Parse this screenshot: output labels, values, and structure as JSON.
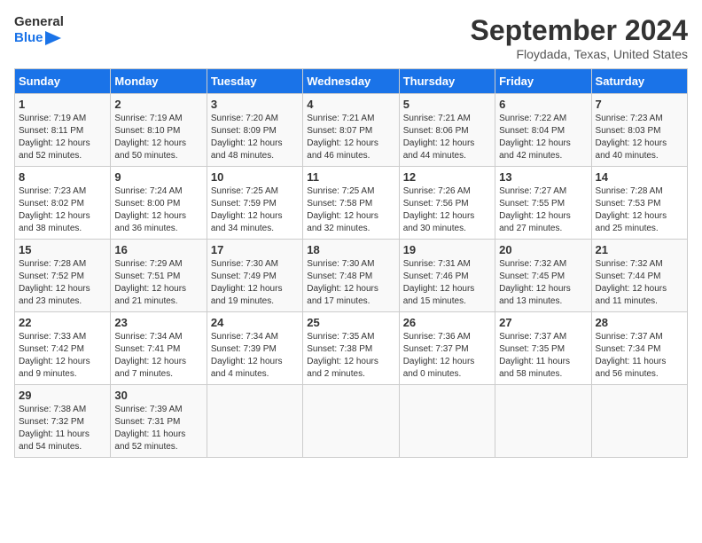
{
  "header": {
    "logo_line1": "General",
    "logo_line2": "Blue",
    "title": "September 2024",
    "subtitle": "Floydada, Texas, United States"
  },
  "columns": [
    "Sunday",
    "Monday",
    "Tuesday",
    "Wednesday",
    "Thursday",
    "Friday",
    "Saturday"
  ],
  "weeks": [
    [
      {
        "day": "1",
        "info": "Sunrise: 7:19 AM\nSunset: 8:11 PM\nDaylight: 12 hours\nand 52 minutes."
      },
      {
        "day": "2",
        "info": "Sunrise: 7:19 AM\nSunset: 8:10 PM\nDaylight: 12 hours\nand 50 minutes."
      },
      {
        "day": "3",
        "info": "Sunrise: 7:20 AM\nSunset: 8:09 PM\nDaylight: 12 hours\nand 48 minutes."
      },
      {
        "day": "4",
        "info": "Sunrise: 7:21 AM\nSunset: 8:07 PM\nDaylight: 12 hours\nand 46 minutes."
      },
      {
        "day": "5",
        "info": "Sunrise: 7:21 AM\nSunset: 8:06 PM\nDaylight: 12 hours\nand 44 minutes."
      },
      {
        "day": "6",
        "info": "Sunrise: 7:22 AM\nSunset: 8:04 PM\nDaylight: 12 hours\nand 42 minutes."
      },
      {
        "day": "7",
        "info": "Sunrise: 7:23 AM\nSunset: 8:03 PM\nDaylight: 12 hours\nand 40 minutes."
      }
    ],
    [
      {
        "day": "8",
        "info": "Sunrise: 7:23 AM\nSunset: 8:02 PM\nDaylight: 12 hours\nand 38 minutes."
      },
      {
        "day": "9",
        "info": "Sunrise: 7:24 AM\nSunset: 8:00 PM\nDaylight: 12 hours\nand 36 minutes."
      },
      {
        "day": "10",
        "info": "Sunrise: 7:25 AM\nSunset: 7:59 PM\nDaylight: 12 hours\nand 34 minutes."
      },
      {
        "day": "11",
        "info": "Sunrise: 7:25 AM\nSunset: 7:58 PM\nDaylight: 12 hours\nand 32 minutes."
      },
      {
        "day": "12",
        "info": "Sunrise: 7:26 AM\nSunset: 7:56 PM\nDaylight: 12 hours\nand 30 minutes."
      },
      {
        "day": "13",
        "info": "Sunrise: 7:27 AM\nSunset: 7:55 PM\nDaylight: 12 hours\nand 27 minutes."
      },
      {
        "day": "14",
        "info": "Sunrise: 7:28 AM\nSunset: 7:53 PM\nDaylight: 12 hours\nand 25 minutes."
      }
    ],
    [
      {
        "day": "15",
        "info": "Sunrise: 7:28 AM\nSunset: 7:52 PM\nDaylight: 12 hours\nand 23 minutes."
      },
      {
        "day": "16",
        "info": "Sunrise: 7:29 AM\nSunset: 7:51 PM\nDaylight: 12 hours\nand 21 minutes."
      },
      {
        "day": "17",
        "info": "Sunrise: 7:30 AM\nSunset: 7:49 PM\nDaylight: 12 hours\nand 19 minutes."
      },
      {
        "day": "18",
        "info": "Sunrise: 7:30 AM\nSunset: 7:48 PM\nDaylight: 12 hours\nand 17 minutes."
      },
      {
        "day": "19",
        "info": "Sunrise: 7:31 AM\nSunset: 7:46 PM\nDaylight: 12 hours\nand 15 minutes."
      },
      {
        "day": "20",
        "info": "Sunrise: 7:32 AM\nSunset: 7:45 PM\nDaylight: 12 hours\nand 13 minutes."
      },
      {
        "day": "21",
        "info": "Sunrise: 7:32 AM\nSunset: 7:44 PM\nDaylight: 12 hours\nand 11 minutes."
      }
    ],
    [
      {
        "day": "22",
        "info": "Sunrise: 7:33 AM\nSunset: 7:42 PM\nDaylight: 12 hours\nand 9 minutes."
      },
      {
        "day": "23",
        "info": "Sunrise: 7:34 AM\nSunset: 7:41 PM\nDaylight: 12 hours\nand 7 minutes."
      },
      {
        "day": "24",
        "info": "Sunrise: 7:34 AM\nSunset: 7:39 PM\nDaylight: 12 hours\nand 4 minutes."
      },
      {
        "day": "25",
        "info": "Sunrise: 7:35 AM\nSunset: 7:38 PM\nDaylight: 12 hours\nand 2 minutes."
      },
      {
        "day": "26",
        "info": "Sunrise: 7:36 AM\nSunset: 7:37 PM\nDaylight: 12 hours\nand 0 minutes."
      },
      {
        "day": "27",
        "info": "Sunrise: 7:37 AM\nSunset: 7:35 PM\nDaylight: 11 hours\nand 58 minutes."
      },
      {
        "day": "28",
        "info": "Sunrise: 7:37 AM\nSunset: 7:34 PM\nDaylight: 11 hours\nand 56 minutes."
      }
    ],
    [
      {
        "day": "29",
        "info": "Sunrise: 7:38 AM\nSunset: 7:32 PM\nDaylight: 11 hours\nand 54 minutes."
      },
      {
        "day": "30",
        "info": "Sunrise: 7:39 AM\nSunset: 7:31 PM\nDaylight: 11 hours\nand 52 minutes."
      },
      {
        "day": "",
        "info": ""
      },
      {
        "day": "",
        "info": ""
      },
      {
        "day": "",
        "info": ""
      },
      {
        "day": "",
        "info": ""
      },
      {
        "day": "",
        "info": ""
      }
    ]
  ]
}
